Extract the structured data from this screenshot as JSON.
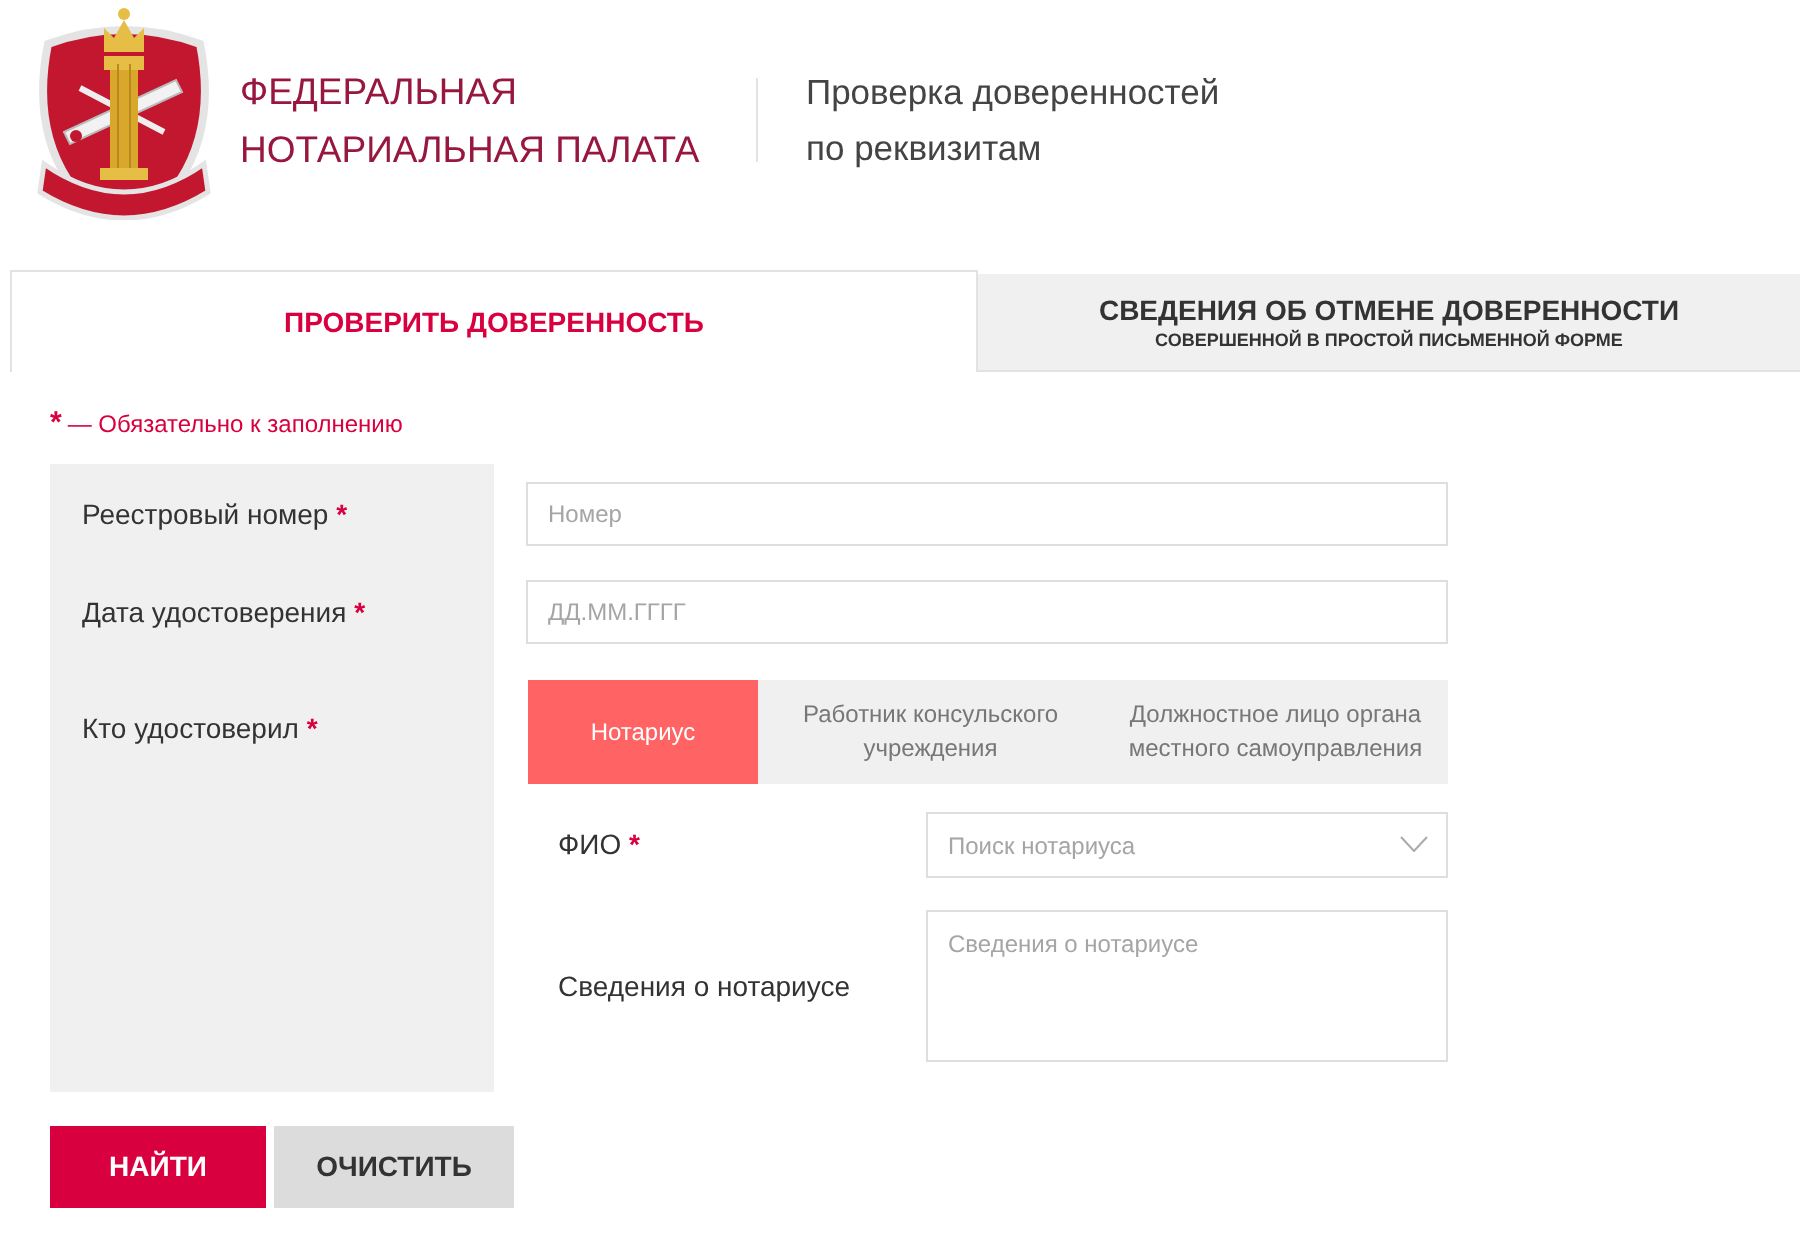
{
  "header": {
    "title_lines": [
      "ФЕДЕРАЛЬНАЯ",
      "НОТАРИАЛЬНАЯ ПАЛАТА"
    ],
    "subtitle_lines": [
      "Проверка доверенностей",
      "по реквизитам"
    ]
  },
  "tabs": [
    {
      "title": "ПРОВЕРИТЬ ДОВЕРЕННОСТЬ",
      "selected": true
    },
    {
      "title": "СВЕДЕНИЯ ОБ ОТМЕНЕ ДОВЕРЕННОСТИ",
      "subtitle": "СОВЕРШЕННОЙ В ПРОСТОЙ ПИСЬМЕННОЙ ФОРМЕ",
      "selected": false
    }
  ],
  "required_note": {
    "mark": "*",
    "text": "— Обязательно к заполнению"
  },
  "fields": [
    {
      "kind": "input",
      "label": "Реестровый номер",
      "required_mark": "*",
      "placeholder": "Номер"
    },
    {
      "kind": "input",
      "label": "Дата удостоверения",
      "required_mark": "*",
      "placeholder": "ДД.ММ.ГГГГ"
    },
    {
      "kind": "segmented",
      "label": "Кто удостоверил",
      "required_mark": "*",
      "options": [
        {
          "label": "Нотариус",
          "selected": true
        },
        {
          "label": "Работник консульского учреждения",
          "selected": false
        },
        {
          "label": "Должностное лицо органа местного самоуправления",
          "selected": false
        }
      ]
    }
  ],
  "notary_fields": [
    {
      "kind": "select",
      "label": "ФИО",
      "required_mark": "*",
      "placeholder": "Поиск нотариуса"
    },
    {
      "kind": "textarea",
      "label": "Сведения о нотариусе",
      "placeholder": "Сведения о нотариусе"
    }
  ],
  "buttons": [
    {
      "kind": "primary",
      "label": "НАЙТИ"
    },
    {
      "kind": "secondary",
      "label": "ОЧИСТИТЬ"
    }
  ]
}
